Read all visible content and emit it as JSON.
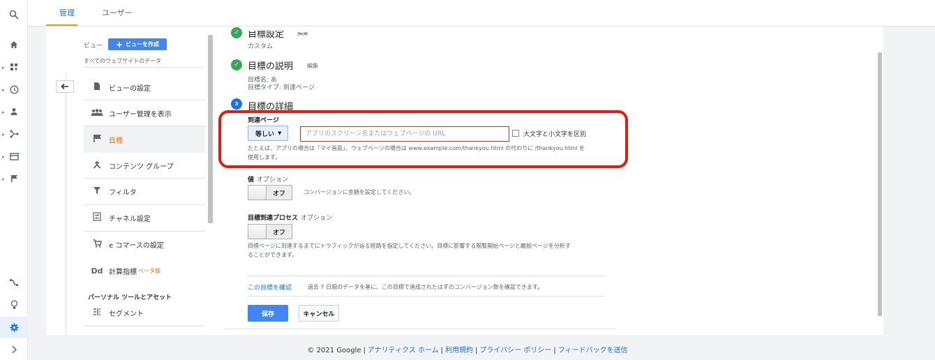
{
  "rail": {
    "icons": [
      "search-icon",
      "home-icon",
      "dashboard-icon",
      "clock-icon",
      "person-icon",
      "acquisition-icon",
      "display-icon",
      "flag-icon"
    ],
    "bottom_icons": [
      "attribution-icon",
      "lightbulb-icon",
      "gear-icon",
      "expand-icon"
    ]
  },
  "tabs": [
    "管理",
    "ユーザー"
  ],
  "nav": {
    "view_label": "ビュー",
    "create_view": "ビューを作成",
    "all_data": "すべてのウェブサイトのデータ",
    "items": [
      {
        "icon": "document-icon",
        "label": "ビューの設定"
      },
      {
        "icon": "users-icon",
        "label": "ユーザー管理を表示"
      },
      {
        "icon": "flag-icon",
        "label": "目標"
      },
      {
        "icon": "content-group-icon",
        "label": "コンテンツ グループ"
      },
      {
        "icon": "filter-icon",
        "label": "フィルタ"
      },
      {
        "icon": "channel-icon",
        "label": "チャネル設定"
      },
      {
        "icon": "cart-icon",
        "label": "e コマースの設定"
      },
      {
        "icon": "dd-icon",
        "label": "計算指標"
      },
      {
        "icon": "segment-icon",
        "label": "セグメント"
      }
    ],
    "beta": "ベータ版",
    "personal_tools": "パーソナル ツールとアセット"
  },
  "goal": {
    "step1_partial": "目標設定",
    "step1_edit": "編集",
    "step1_value": "カスタム",
    "step2_title": "目標の説明",
    "step2_edit": "編集",
    "goal_name": "目標名: あ",
    "goal_type": "目標タイプ: 到達ページ",
    "step3_title": "目標の詳細",
    "step3_number": "3",
    "dest_label": "到達ページ",
    "match_type": "等しい",
    "url_placeholder": "アプリのスクリーン名またはウェブページの URL",
    "case_sensitive": "大文字と小文字を区別",
    "hint_line1": "たとえば、アプリの場合は「マイ画面」、ウェブページの場合は www.example.com/thankyou.html の代わりに /thankyou.html を",
    "hint_line2": "使用します。",
    "value_label": "値",
    "value_option": "オプション",
    "value_toggle": "オフ",
    "value_desc": "コンバージョンに金額を設定してください。",
    "funnel_label": "目標到達プロセス",
    "funnel_option": "オプション",
    "funnel_toggle": "オフ",
    "funnel_desc1": "目標ページに到達するまでにトラフィックが辿る経路を指定してください。目標に影響する閲覧開始ページと離脱ページを分析す",
    "funnel_desc2": "ることができます。",
    "verify_link": "この目標を確認",
    "verify_desc": "過去 7 日間のデータを基に、この目標で達成されたはずのコンバージョン数を確認できます。",
    "save": "保存",
    "cancel": "キャンセル"
  },
  "footer": {
    "copyright": "© 2021 Google",
    "links": [
      "アナリティクス ホーム",
      "利用規約",
      "プライバシー ポリシー",
      "フィードバックを送信"
    ]
  },
  "colors": {
    "accent": "#1a73e8",
    "button": "#4285f4",
    "highlight": "#e8190f",
    "selected": "#e8710a"
  }
}
